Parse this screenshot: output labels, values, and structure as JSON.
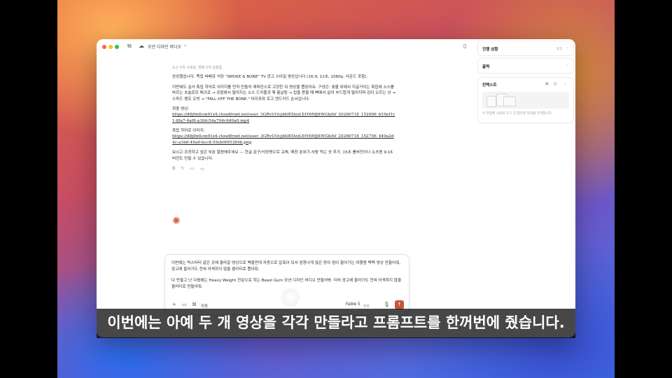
{
  "window": {
    "title": "모션 디자인 비디오",
    "sidebar_toggle_icon": "sidebar-toggle-icon",
    "cloud_icon": "cloud-icon"
  },
  "chat": {
    "tools_line": "도구 5개 사용됨, 명령 3개 실행함",
    "intro": "완성했습니다. 족립 바베큐 식당 \"SMOKE & BONE\" TV 광고 스타일 영상입니다 (16:9, 12초, 1080p, 사운드 포함).",
    "description": "이번에도 실사 폭립 히어로 이미지를 먼저 만들어 레퍼런스로 고정한 뒤 영상을 뽑았어요. 구성은: 숯불 위에서 지글거리는 폭립에 소스를 바르는 초슬로모 매크로 → 공중에서 떨어지는 소스 드리즐과 깨 흩날림 → 립을 뜯을 때 뼈에서 살이 부드럽게 떨어지며 김이 오르는 샷 → 스피드 램프 오빗 → \"FALL OFF THE BONE.\" 타이포와 로고 엔드카드 순서입니다.",
    "final_video_label": "최종 영상:",
    "final_video_url": "https://d8j0ntlcm91z4.cloudfront.net/user_3GRvUOcjdhIEDzzLEtY6MJttWGb/hf_20260718_152906_b19ef1c1-8fa7-4af8-a30d-54a794c6d0a0.mp4",
    "hero_image_label": "폭립 히어로 이미지:",
    "hero_image_url": "https://d8j0ntlcm91z4.cloudfront.net/user_3GRvUOcjdhIEDzzLEtY6MJttWGb/hf_20260718_152756_449a2d4c-a1b6-49a9-bcc8-55eb9f95384b.png",
    "followup": "보시고 조정하고 싶은 부분 말씀해주세요 — 한글 문구/식당명으로 교체, 매장 분위기·사람 먹는 샷 추가, 15초 롤버전이나 쇼츠용 9:16 버전도 만들 수 있습니다.",
    "action_icons": [
      "copy-icon",
      "retry-icon",
      "thumbs-up-icon",
      "thumbs-down-icon"
    ]
  },
  "composer": {
    "line1": "이번에는 릭스타터 같은 곳에 올라갈 영상으로 벽돌만데 자동으로 압축이 되서 엄청나게 많은 양의 짐이 들어가는 여행용 백팩 영상 만들어줘, 광고에 들어가도 전혀 어색하지 않을 퀄리티로 뽑아줘.",
    "line2": "다 만들고 난 다음에는 Heavy Weight 전문으로 하는 Beast Gym 모션 디자인 비디오 만들어봐. 티비 광고에 들어가도 전혀 어색하지 않을 퀄리티로 만들어줘.",
    "mode_label": "자동",
    "model_label": "Fable 5",
    "effort_label": "높음"
  },
  "right_panel": {
    "progress_title": "진행 상황",
    "progress_count": "1/1",
    "output_title": "출력",
    "context_title": "컨텍스트",
    "context_desc": "이 작업에 사용된 도구 및 참조된 파일을 추적합니다."
  },
  "subtitle": "이번에는 아예 두 개 영상을 각각 만들라고 프롬프트를 한꺼번에 줬습니다."
}
